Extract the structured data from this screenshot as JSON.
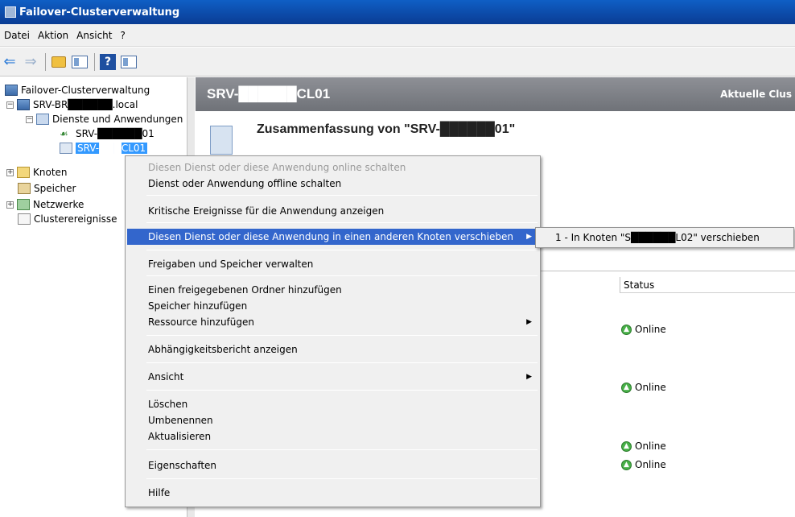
{
  "window": {
    "title": "Failover-Clusterverwaltung"
  },
  "menu": [
    "Datei",
    "Aktion",
    "Ansicht",
    "?"
  ],
  "toolbar": {
    "icons": [
      "back-arrow-icon",
      "forward-arrow-icon",
      "up-folder-icon",
      "show-hide-tree-icon",
      "help-icon",
      "show-action-pane-icon"
    ]
  },
  "tree": {
    "root": "Failover-Clusterverwaltung",
    "cluster": "SRV-BR██████.local",
    "services": "Dienste und Anwendungen",
    "service1": "SRV-██████01",
    "service2": "SRV-███CL01",
    "nodes": "Knoten",
    "storage": "Speicher",
    "networks": "Netzwerke",
    "events": "Clusterereignisse"
  },
  "content": {
    "header_title": "SRV-██████CL01",
    "header_right": "Aktuelle Clus",
    "summary_title": "Zusammenfassung von \"SRV-██████01\"",
    "status_header": "Status",
    "statuses": [
      "Online",
      "Online",
      "Online",
      "Online"
    ]
  },
  "context_menu": {
    "items": [
      {
        "label": "Diesen Dienst oder diese Anwendung online schalten",
        "disabled": true
      },
      {
        "label": "Dienst oder Anwendung offline schalten"
      },
      {
        "label": "Kritische Ereignisse für die Anwendung anzeigen"
      },
      {
        "label": "Diesen Dienst oder diese Anwendung in einen anderen Knoten verschieben",
        "submenu": true,
        "highlighted": true
      },
      {
        "label": "Freigaben und Speicher verwalten"
      },
      {
        "label": "Einen freigegebenen Ordner hinzufügen"
      },
      {
        "label": "Speicher hinzufügen"
      },
      {
        "label": "Ressource hinzufügen",
        "submenu": true
      },
      {
        "label": "Abhängigkeitsbericht anzeigen"
      },
      {
        "label": "Ansicht",
        "submenu": true
      },
      {
        "label": "Löschen"
      },
      {
        "label": "Umbenennen"
      },
      {
        "label": "Aktualisieren"
      },
      {
        "label": "Eigenschaften"
      },
      {
        "label": "Hilfe"
      }
    ]
  },
  "submenu": {
    "item": "1 - In Knoten \"S██████L02\" verschieben"
  }
}
